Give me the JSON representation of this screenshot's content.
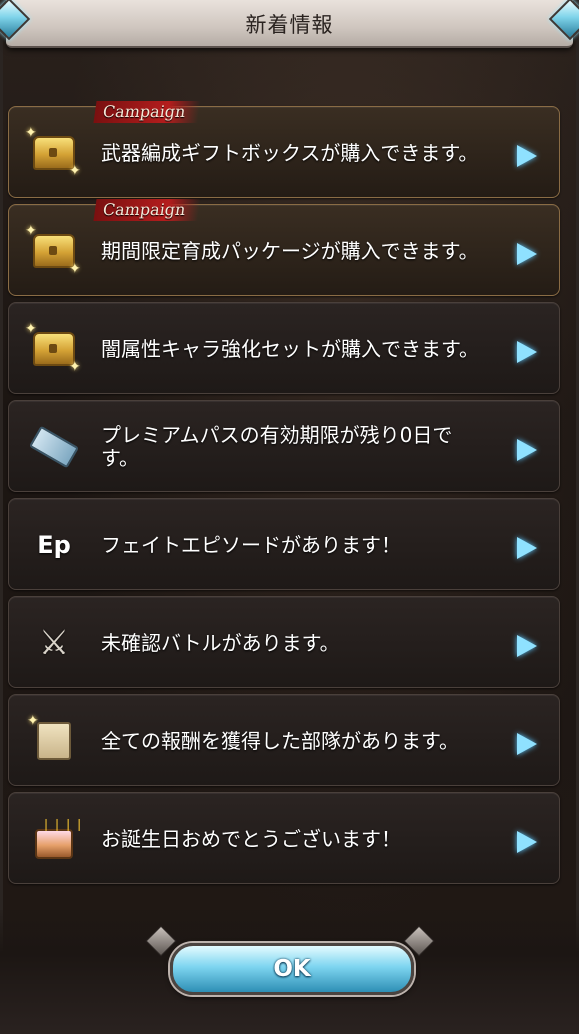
{
  "dialog": {
    "title": "新着情報",
    "ok_label": "OK"
  },
  "items": [
    {
      "badge": "Campaign",
      "text": "武器編成ギフトボックスが購入できます。",
      "icon": "treasure-chest-icon"
    },
    {
      "badge": "Campaign",
      "text": "期間限定育成パッケージが購入できます。",
      "icon": "treasure-chest-icon"
    },
    {
      "badge": "",
      "text": "闇属性キャラ強化セットが購入できます。",
      "icon": "treasure-chest-icon"
    },
    {
      "badge": "",
      "text": "プレミアムパスの有効期限が残り0日です。",
      "icon": "ticket-icon"
    },
    {
      "badge": "",
      "text": "フェイトエピソードがあります！",
      "icon": "ep-icon",
      "icon_text": "Ep"
    },
    {
      "badge": "",
      "text": "未確認バトルがあります。",
      "icon": "crossed-swords-icon"
    },
    {
      "badge": "",
      "text": "全ての報酬を獲得した部隊があります。",
      "icon": "scroll-icon"
    },
    {
      "badge": "",
      "text": "お誕生日おめでとうございます！",
      "icon": "birthday-cake-icon"
    }
  ],
  "colors": {
    "arrow": "#8fe1ff",
    "badge": "#b41d1d"
  }
}
